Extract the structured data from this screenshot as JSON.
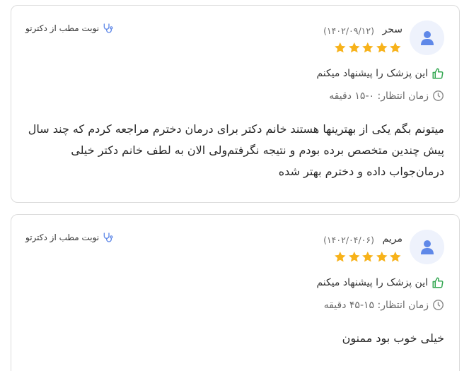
{
  "reviews": [
    {
      "user_name": "سحر",
      "date": "(۱۴۰۲/۰۹/۱۲)",
      "rating": 5,
      "center_label": "نوبت مطب از دکترتو",
      "recommend_text": "این پزشک را پیشنهاد میکنم",
      "wait_time": "زمان انتظار: ۰-۱۵ دقیقه",
      "text": "میتونم بگم یکی از بهترینها هستند خانم دکتر برای درمان دخترم مراجعه کردم که چند سال پیش چندین متخصص برده بودم و نتیجه نگرفتم‌ولی الان به لطف خانم دکتر خیلی درمان‌جواب داده و دخترم بهتر شده"
    },
    {
      "user_name": "مریم",
      "date": "(۱۴۰۲/۰۴/۰۶)",
      "rating": 5,
      "center_label": "نوبت مطب از دکترتو",
      "recommend_text": "این پزشک را پیشنهاد میکنم",
      "wait_time": "زمان انتظار: ۱۵-۴۵ دقیقه",
      "text": "خیلی خوب بود ممنون"
    }
  ],
  "colors": {
    "star": "#f7b21a",
    "avatar_bg": "#eef2fc",
    "avatar_icon": "#5f88e8",
    "thumb": "#35a853",
    "stethoscope": "#5f88e8",
    "clock": "#8a8a8a"
  },
  "icons": [
    "user-avatar-icon",
    "star-icon",
    "stethoscope-icon",
    "thumbs-up-icon",
    "clock-icon"
  ]
}
